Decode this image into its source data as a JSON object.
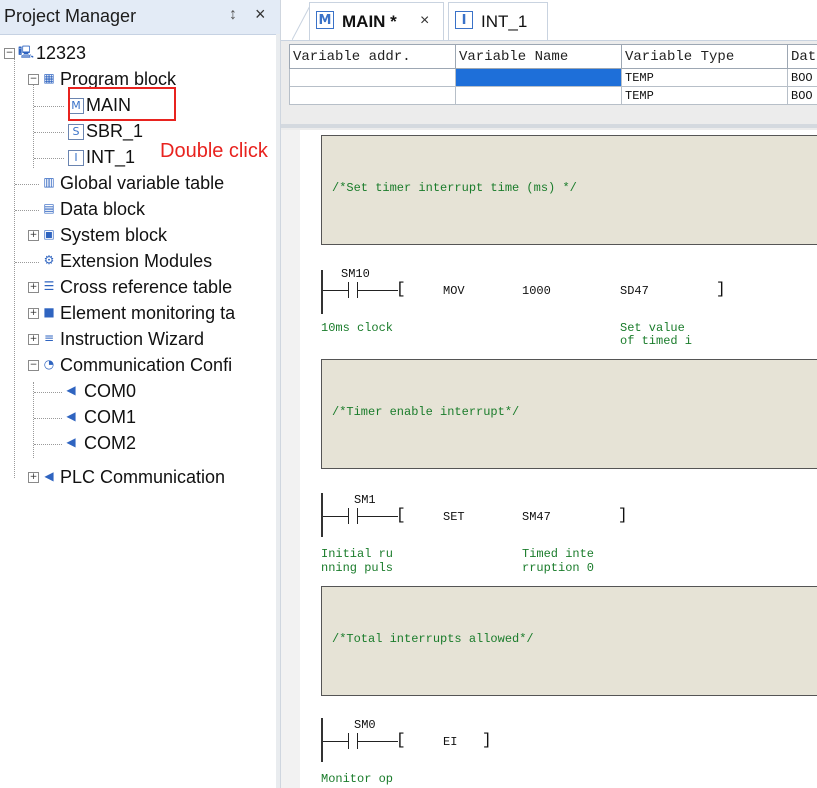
{
  "project_manager": {
    "title": "Project Manager",
    "pin_glyph": "↕",
    "close_glyph": "×",
    "tree": [
      {
        "label": "12323",
        "icon": "pc-icon"
      },
      {
        "label": "Program block",
        "icon": "program-block-icon"
      },
      {
        "label": "MAIN",
        "icon": "main-program-icon"
      },
      {
        "label": "SBR_1",
        "icon": "subroutine-icon"
      },
      {
        "label": "INT_1",
        "icon": "interrupt-icon"
      },
      {
        "label": "Global variable table",
        "icon": "chart-icon"
      },
      {
        "label": "Data block",
        "icon": "document-icon"
      },
      {
        "label": "System block",
        "icon": "system-block-icon"
      },
      {
        "label": "Extension Modules",
        "icon": "gear-icon"
      },
      {
        "label": "Cross reference table",
        "icon": "list-icon"
      },
      {
        "label": "Element monitoring ta",
        "icon": "monitor-icon"
      },
      {
        "label": "Instruction Wizard",
        "icon": "wizard-icon"
      },
      {
        "label": "Communication Confi",
        "icon": "communication-icon"
      },
      {
        "label": "COM0",
        "icon": "port-icon"
      },
      {
        "label": "COM1",
        "icon": "port-icon"
      },
      {
        "label": "COM2",
        "icon": "port-icon"
      },
      {
        "label": "PLC Communication",
        "icon": "port-icon"
      }
    ],
    "annotation": "Double click",
    "annotation_color": "#e8231f"
  },
  "tabs": [
    {
      "label": "MAIN *",
      "icon_letter": "M",
      "close": "×",
      "active": true
    },
    {
      "label": "INT_1",
      "icon_letter": "I",
      "active": false
    }
  ],
  "variable_table": {
    "headers": [
      "Variable addr.",
      "Variable Name",
      "Variable Type",
      "Dat"
    ],
    "rows": [
      [
        "",
        "",
        "TEMP",
        "BOO"
      ],
      [
        "",
        "",
        "TEMP",
        "BOO"
      ]
    ]
  },
  "ladder": {
    "networks": [
      {
        "comment": "/*Set timer interrupt time (ms) */",
        "contact": "SM10",
        "instruction": "MOV",
        "operand1": "1000",
        "operand2": "SD47",
        "contact_comment": [
          "10ms clock"
        ],
        "operand_comment": [
          "Set value",
          "of timed i"
        ]
      },
      {
        "comment": "/*Timer enable interrupt*/",
        "contact": "SM1",
        "instruction": "SET",
        "operand1": "SM47",
        "contact_comment": [
          "Initial ru",
          "nning puls"
        ],
        "operand_comment": [
          "Timed inte",
          "rruption 0"
        ]
      },
      {
        "comment": "/*Total interrupts allowed*/",
        "contact": "SM0",
        "instruction": "EI",
        "contact_comment": [
          "Monitor op"
        ]
      }
    ]
  }
}
